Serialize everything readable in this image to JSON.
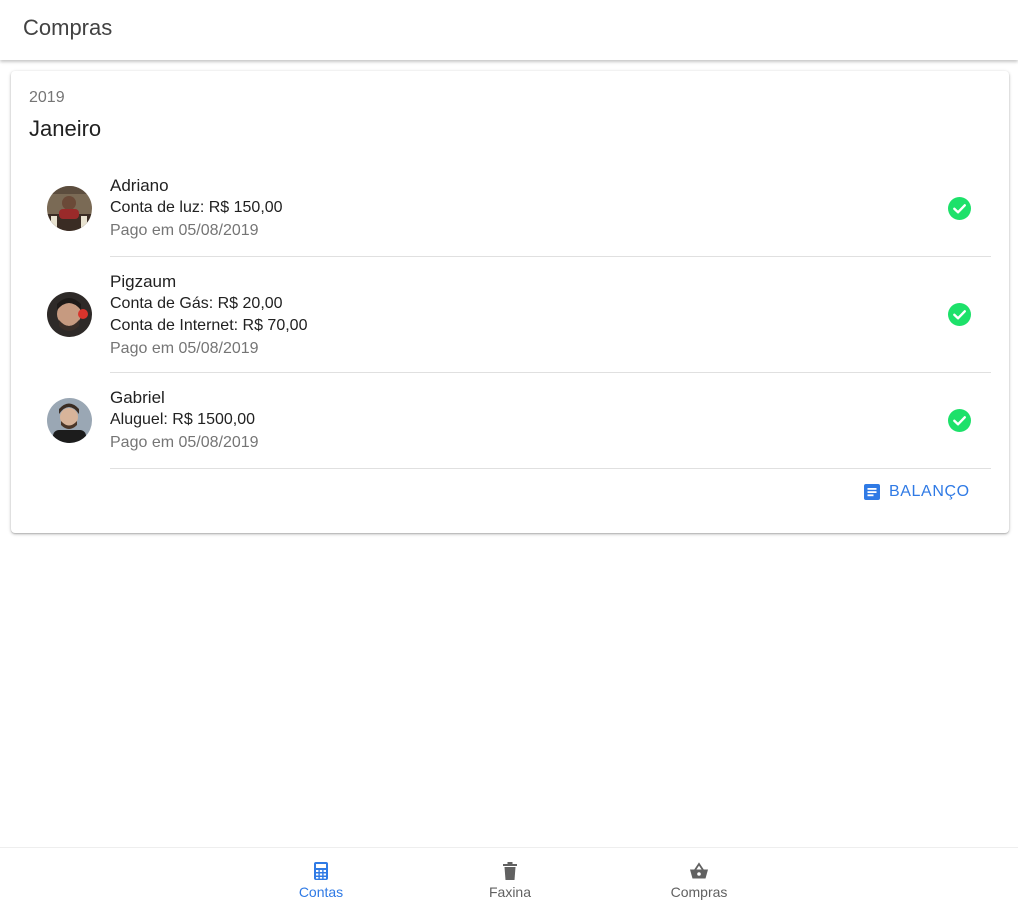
{
  "appbar": {
    "title": "Compras"
  },
  "card": {
    "year": "2019",
    "month": "Janeiro",
    "items": [
      {
        "name": "Adriano",
        "lines": [
          "Conta de luz: R$ 150,00"
        ],
        "paid": "Pago em 05/08/2019"
      },
      {
        "name": "Pigzaum",
        "lines": [
          "Conta de Gás: R$ 20,00",
          "Conta de Internet: R$ 70,00"
        ],
        "paid": "Pago em 05/08/2019"
      },
      {
        "name": "Gabriel",
        "lines": [
          "Aluguel: R$ 1500,00"
        ],
        "paid": "Pago em 05/08/2019"
      }
    ],
    "action_label": "BALANÇO"
  },
  "bottom_nav": {
    "items": [
      {
        "label": "Contas",
        "icon": "calculator-icon",
        "active": true
      },
      {
        "label": "Faxina",
        "icon": "trash-icon",
        "active": false
      },
      {
        "label": "Compras",
        "icon": "basket-icon",
        "active": false
      }
    ]
  },
  "colors": {
    "accent": "#2f7ae5",
    "success": "#1de16a",
    "text_secondary": "#757575"
  }
}
